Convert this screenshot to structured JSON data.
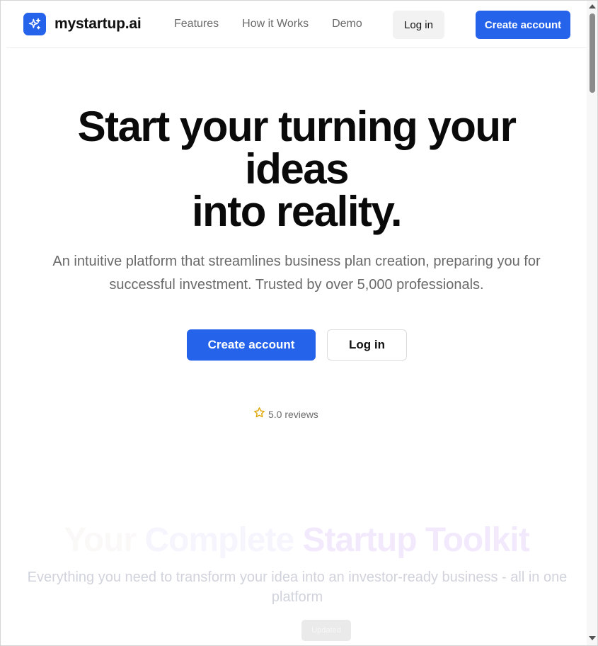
{
  "brand": {
    "name": "mystartup.ai",
    "icon": "sparkles-icon",
    "accent": "#2563eb"
  },
  "nav": {
    "links": [
      {
        "label": "Features"
      },
      {
        "label": "How it Works"
      },
      {
        "label": "Demo"
      }
    ],
    "login_label": "Log in",
    "create_label": "Create account"
  },
  "hero": {
    "title_line1": "Start your turning your",
    "title_line2": "ideas",
    "title_line3": "into reality.",
    "subtitle": "An intuitive platform that streamlines business plan creation, preparing you for successful investment. Trusted by over 5,000 professionals.",
    "create_label": "Create account",
    "login_label": "Log in",
    "reviews_icon": "star-icon",
    "reviews_text": "5.0 reviews"
  },
  "toolkit": {
    "title_part1": "Your ",
    "title_part2": "Complete ",
    "title_part3": "Startup Toolkit",
    "subtitle": "Everything you need to transform your idea into an investor-ready business - all in one platform",
    "badge": "Updated"
  }
}
